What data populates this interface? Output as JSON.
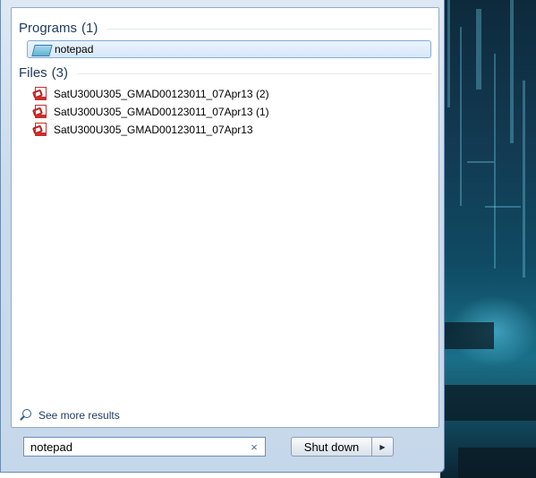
{
  "results": {
    "programs_header": {
      "label": "Programs",
      "count": "(1)"
    },
    "programs": [
      {
        "label": "notepad",
        "icon": "notepad-icon"
      }
    ],
    "files_header": {
      "label": "Files",
      "count": "(3)"
    },
    "files": [
      {
        "label": "SatU300U305_GMAD00123011_07Apr13 (2)",
        "icon": "pdf-icon"
      },
      {
        "label": "SatU300U305_GMAD00123011_07Apr13 (1)",
        "icon": "pdf-icon"
      },
      {
        "label": "SatU300U305_GMAD00123011_07Apr13",
        "icon": "pdf-icon"
      }
    ],
    "see_more": "See more results"
  },
  "search": {
    "value": "notepad",
    "clear_glyph": "×"
  },
  "shutdown": {
    "label": "Shut down",
    "arrow_glyph": "▶"
  },
  "colors": {
    "header_text": "#1e395b",
    "selection_border": "#84acd6",
    "pdf_red": "#c0201f"
  }
}
